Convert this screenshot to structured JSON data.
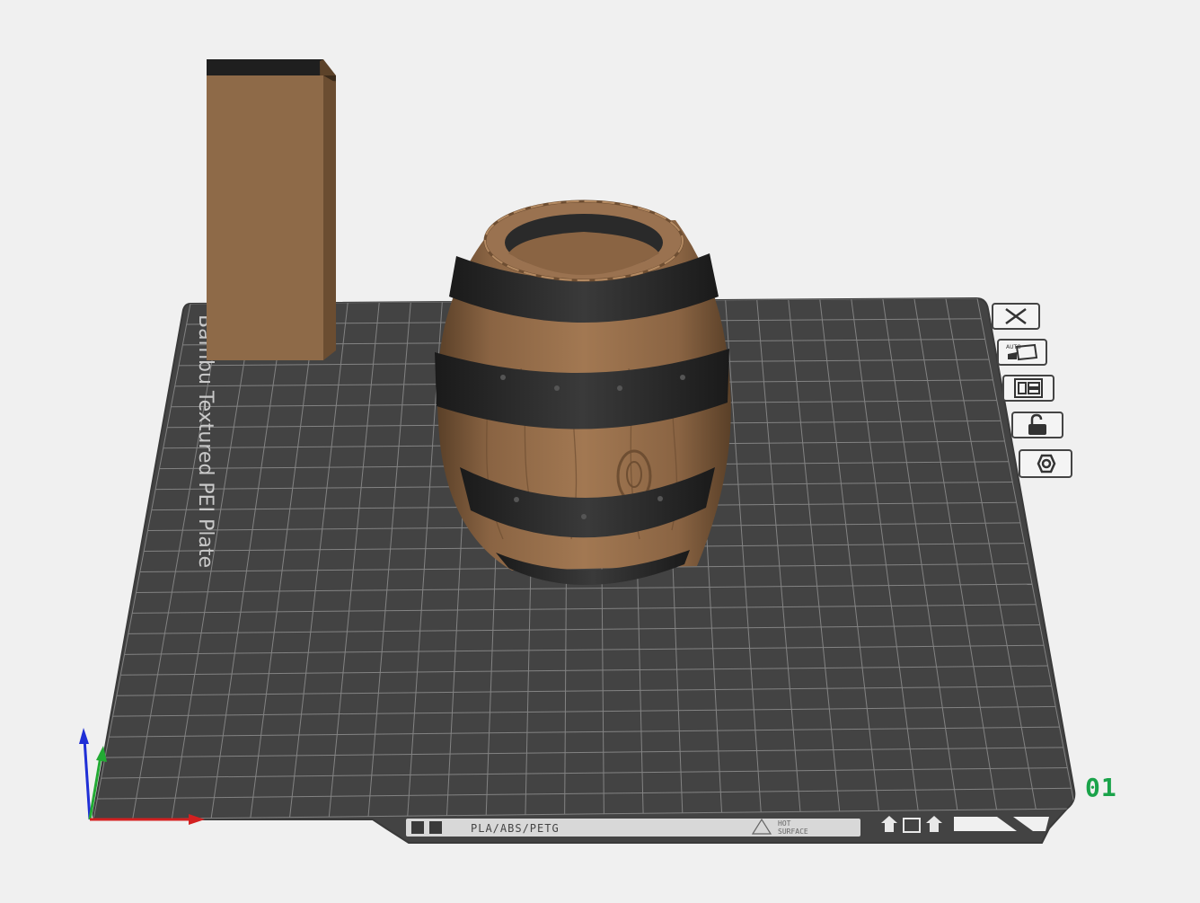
{
  "plate": {
    "name": "Bambu Textured PEI Plate",
    "number": "01",
    "filament_label": "PLA/ABS/PETG",
    "warning_line1": "HOT",
    "warning_line2": "SURFACE"
  },
  "toolbar": {
    "close_icon": "close-icon",
    "auto_orient_label": "AUTO",
    "arrange_icon": "arrange-icon",
    "lock_icon": "unlock-icon",
    "settings_icon": "gear-icon"
  },
  "colors": {
    "plate": "#434343",
    "grid": "#8a8a8a",
    "wood": "#8e6a48",
    "hoop": "#2b2b2b",
    "plate_number": "#1aa34a",
    "axis_x": "#d32020",
    "axis_y": "#22aa33",
    "axis_z": "#1f2fd6"
  }
}
